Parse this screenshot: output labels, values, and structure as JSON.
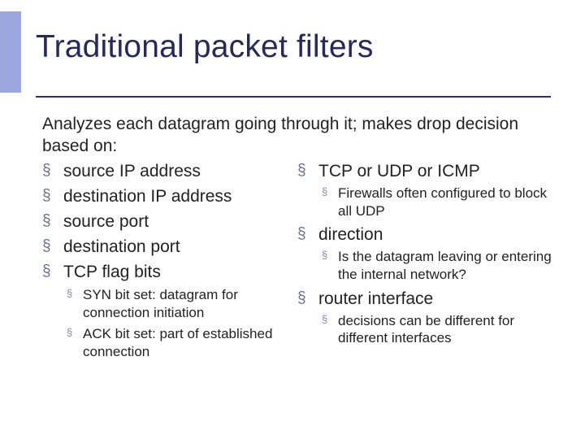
{
  "title": "Traditional packet filters",
  "intro": "Analyzes each datagram going through it; makes drop decision based on:",
  "left": {
    "items": [
      "source IP address",
      "destination IP address",
      "source port",
      "destination port",
      "TCP flag bits"
    ],
    "sub_after_last": [
      "SYN bit set: datagram for connection initiation",
      "ACK bit set: part of established connection"
    ]
  },
  "right": {
    "items": [
      {
        "label": "TCP or UDP or ICMP",
        "sub": [
          "Firewalls often configured to block all UDP"
        ]
      },
      {
        "label": "direction",
        "sub": [
          "Is the datagram leaving or entering the internal network?"
        ]
      },
      {
        "label": "router interface",
        "sub": [
          "decisions can be different for different interfaces"
        ]
      }
    ]
  }
}
